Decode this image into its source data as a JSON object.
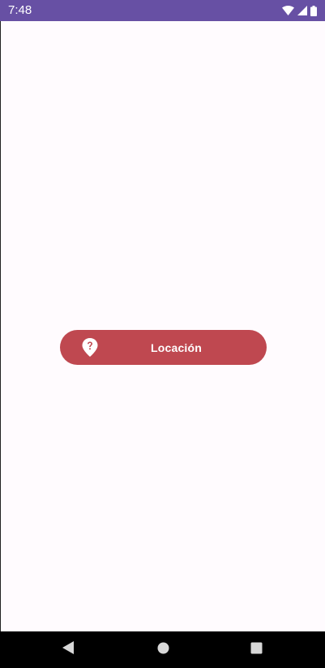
{
  "status_bar": {
    "time": "7:48",
    "icons": [
      "wifi-icon",
      "cellular-signal-icon",
      "battery-icon"
    ],
    "background_color": "#6750A4"
  },
  "screen": {
    "background_color": "#FFFBFE"
  },
  "location_button": {
    "label": "Locación",
    "icon": "location-unknown-icon",
    "color": "#BF4850"
  },
  "nav_bar": {
    "buttons": [
      "back-icon",
      "home-icon",
      "recents-icon"
    ]
  }
}
